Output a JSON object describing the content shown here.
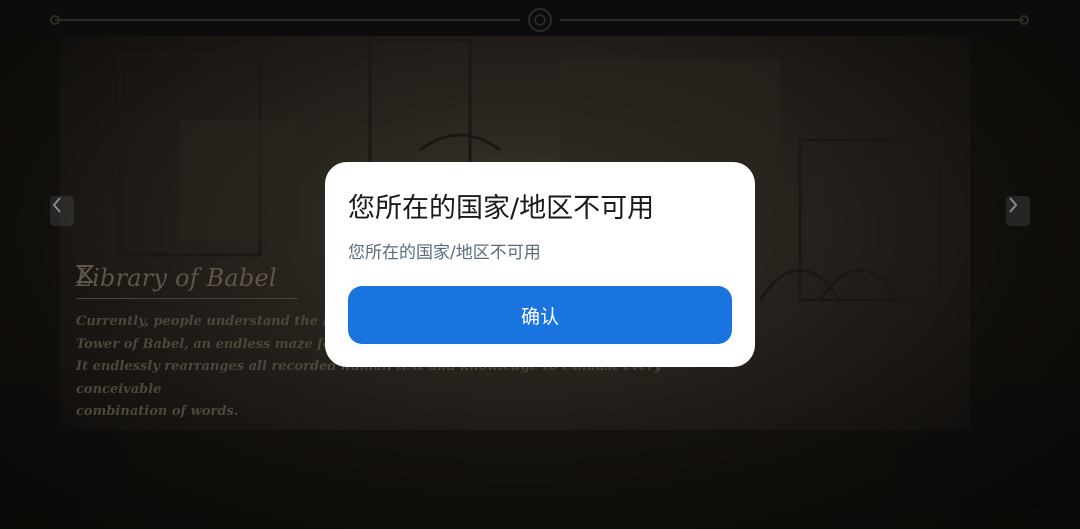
{
  "background": {
    "section_title": "Library of Babel",
    "description": "Currently, people understand the Library of Babel as the Tower of Babel, an endless maze formed of countless hexagonal rooms. It endlessly rearranges all recorded human text and knowledge to exhaust every conceivable combination of words.",
    "description_lines": [
      "Currently, people understand the Libra",
      "Tower of Babel, an endless maze forme",
      "It endlessly rearranges all recorded human text and knowledge to exhaust every conceivable",
      "combination of words."
    ]
  },
  "dialog": {
    "title": "您所在的国家/地区不可用",
    "message": "您所在的国家/地区不可用",
    "confirm_label": "确认"
  },
  "colors": {
    "accent": "#1a74e0",
    "dialog_bg": "#ffffff",
    "overlay_dark": "#050505"
  },
  "icons": {
    "prev": "chevron-left-icon",
    "next": "chevron-right-icon",
    "section": "hourglass-icon",
    "rail_emblem": "emblem-icon"
  }
}
